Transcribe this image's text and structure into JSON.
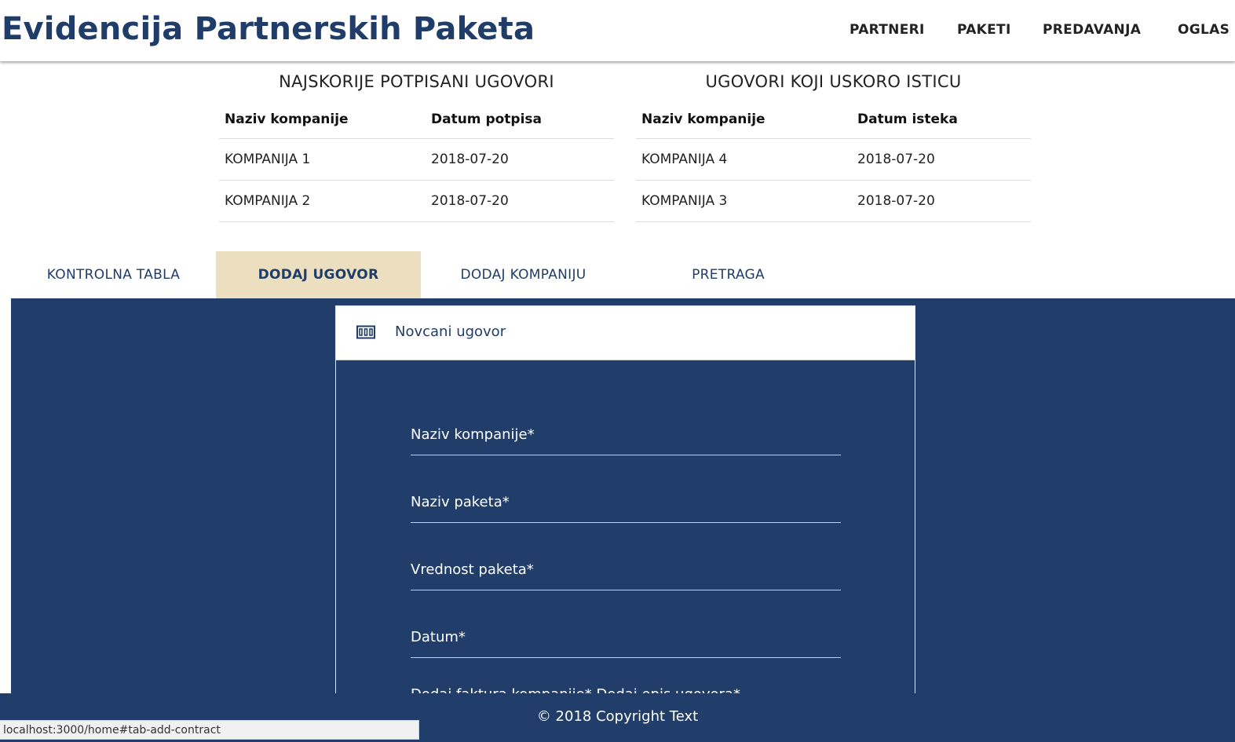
{
  "header": {
    "title": "Evidencija Partnerskih Paketa",
    "nav": [
      "PARTNERI",
      "PAKETI",
      "PREDAVANJA",
      "OGLAS"
    ]
  },
  "recent_signed": {
    "title": "NAJSKORIJE POTPISANI UGOVORI",
    "columns": [
      "Naziv kompanije",
      "Datum potpisa"
    ],
    "rows": [
      [
        "KOMPANIJA 1",
        "2018-07-20"
      ],
      [
        "KOMPANIJA 2",
        "2018-07-20"
      ]
    ]
  },
  "expiring_soon": {
    "title": "UGOVORI KOJI USKORO ISTICU",
    "columns": [
      "Naziv kompanije",
      "Datum isteka"
    ],
    "rows": [
      [
        "KOMPANIJA 4",
        "2018-07-20"
      ],
      [
        "KOMPANIJA 3",
        "2018-07-20"
      ]
    ]
  },
  "tabs": [
    "KONTROLNA TABLA",
    "DODAJ UGOVOR",
    "DODAJ KOMPANIJU",
    "PRETRAGA"
  ],
  "active_tab": "DODAJ UGOVOR",
  "form": {
    "card_title": "Novcani ugovor",
    "card_icon": "money-icon",
    "fields": [
      {
        "placeholder": "Naziv kompanije*",
        "value": ""
      },
      {
        "placeholder": "Naziv paketa*",
        "value": ""
      },
      {
        "placeholder": "Vrednost paketa*",
        "value": ""
      },
      {
        "placeholder": "Datum*",
        "value": ""
      }
    ],
    "partial_row_text": "Dodaj faktura kompanije*        Dodaj opis ugovora*"
  },
  "footer": {
    "text": "© 2018 Copyright Text"
  },
  "status_url": "localhost:3000/home#tab-add-contract",
  "colors": {
    "brand": "#1f3d68",
    "panel": "#213d69",
    "active_tab": "#ecdfbf"
  }
}
